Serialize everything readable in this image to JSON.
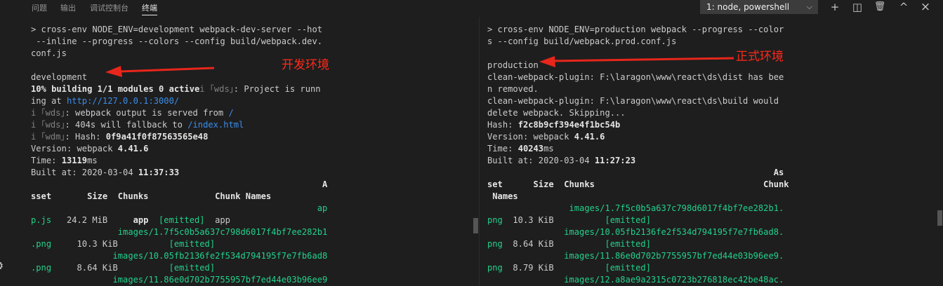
{
  "panel_tabs": [
    {
      "label": "问题"
    },
    {
      "label": "输出"
    },
    {
      "label": "调试控制台"
    },
    {
      "label": "终端"
    }
  ],
  "terminal_select": {
    "value": "1: node, powershell"
  },
  "toolbar": {
    "add_icon": "+",
    "split_icon": "◫",
    "trash_icon": "🗑",
    "maximize_icon": "^",
    "close_icon": "×"
  },
  "annotations": {
    "left": "开发环境",
    "right": "正式环境"
  },
  "left_terminal": [
    [
      {
        "t": "> cross-env NODE_ENV=development webpack-dev-server --hot",
        "c": "w"
      }
    ],
    [
      {
        "t": " --inline --progress --colors --config build/webpack.dev.",
        "c": "w"
      }
    ],
    [
      {
        "t": "conf.js",
        "c": "w"
      }
    ],
    [
      {
        "t": "",
        "c": "w"
      }
    ],
    [
      {
        "t": "development",
        "c": "w"
      }
    ],
    [
      {
        "t": "10% building 1/1 modules 0 active",
        "c": "b"
      },
      {
        "t": "i ｢wds｣",
        "c": "gr"
      },
      {
        "t": ": Project is runn",
        "c": "w"
      }
    ],
    [
      {
        "t": "ing at ",
        "c": "w"
      },
      {
        "t": "http://127.0.0.1:3000/",
        "c": "u"
      }
    ],
    [
      {
        "t": "i ｢wds｣",
        "c": "gr"
      },
      {
        "t": ": webpack output is served from ",
        "c": "w"
      },
      {
        "t": "/",
        "c": "u"
      }
    ],
    [
      {
        "t": "i ｢wds｣",
        "c": "gr"
      },
      {
        "t": ": 404s will fallback to ",
        "c": "w"
      },
      {
        "t": "/index.html",
        "c": "u"
      }
    ],
    [
      {
        "t": "i ｢wdm｣",
        "c": "gr"
      },
      {
        "t": ": Hash: ",
        "c": "w"
      },
      {
        "t": "0f9a41f0f87563565e48",
        "c": "b"
      }
    ],
    [
      {
        "t": "Version: webpack ",
        "c": "w"
      },
      {
        "t": "4.41.6",
        "c": "b"
      }
    ],
    [
      {
        "t": "Time: ",
        "c": "w"
      },
      {
        "t": "13119",
        "c": "b"
      },
      {
        "t": "ms",
        "c": "w"
      }
    ],
    [
      {
        "t": "Built at: 2020-03-04 ",
        "c": "w"
      },
      {
        "t": "11:37:33",
        "c": "b"
      }
    ],
    [
      {
        "t": "                                                         A",
        "c": "b"
      }
    ],
    [
      {
        "t": "sset       Size  Chunks             Chunk Names",
        "c": "b"
      }
    ],
    [
      {
        "t": "                                                        ap",
        "c": "g"
      }
    ],
    [
      {
        "t": "p.js",
        "c": "g"
      },
      {
        "t": "   24.2 MiB     ",
        "c": "w"
      },
      {
        "t": "app",
        "c": "b"
      },
      {
        "t": "  ",
        "c": "w"
      },
      {
        "t": "[emitted]",
        "c": "g"
      },
      {
        "t": "  app",
        "c": "w"
      }
    ],
    [
      {
        "t": "                 images/1.7f5c0b5a637c798d6017f4bf7ee282b1",
        "c": "g"
      }
    ],
    [
      {
        "t": ".png",
        "c": "g"
      },
      {
        "t": "     10.3 KiB          ",
        "c": "w"
      },
      {
        "t": "[emitted]",
        "c": "g"
      }
    ],
    [
      {
        "t": "                images/10.05fb2136fe2f534d794195f7e7fb6ad8",
        "c": "g"
      }
    ],
    [
      {
        "t": ".png",
        "c": "g"
      },
      {
        "t": "     8.64 KiB          ",
        "c": "w"
      },
      {
        "t": "[emitted]",
        "c": "g"
      }
    ],
    [
      {
        "t": "                images/11.86e0d702b7755957bf7ed44e03b96ee9",
        "c": "g"
      }
    ]
  ],
  "right_terminal": [
    [
      {
        "t": "> cross-env NODE_ENV=production webpack --progress --color",
        "c": "w"
      }
    ],
    [
      {
        "t": "s --config build/webpack.prod.conf.js",
        "c": "w"
      }
    ],
    [
      {
        "t": "",
        "c": "w"
      }
    ],
    [
      {
        "t": "production",
        "c": "w"
      }
    ],
    [
      {
        "t": "clean-webpack-plugin: F:\\laragon\\www\\react\\ds\\dist has bee",
        "c": "w"
      }
    ],
    [
      {
        "t": "n removed.",
        "c": "w"
      }
    ],
    [
      {
        "t": "clean-webpack-plugin: F:\\laragon\\www\\react\\ds\\build would",
        "c": "w"
      }
    ],
    [
      {
        "t": "delete webpack. Skipping...",
        "c": "w"
      }
    ],
    [
      {
        "t": "Hash: ",
        "c": "w"
      },
      {
        "t": "f2c8b9cf394e4f1bc54b",
        "c": "b"
      }
    ],
    [
      {
        "t": "Version: webpack ",
        "c": "w"
      },
      {
        "t": "4.41.6",
        "c": "b"
      }
    ],
    [
      {
        "t": "Time: ",
        "c": "w"
      },
      {
        "t": "40243",
        "c": "b"
      },
      {
        "t": "ms",
        "c": "w"
      }
    ],
    [
      {
        "t": "Built at: 2020-03-04 ",
        "c": "w"
      },
      {
        "t": "11:27:23",
        "c": "b"
      }
    ],
    [
      {
        "t": "                                                        As",
        "c": "b"
      }
    ],
    [
      {
        "t": "set      Size  Chunks                                 Chunk",
        "c": "b"
      }
    ],
    [
      {
        "t": " Names",
        "c": "b"
      }
    ],
    [
      {
        "t": "                images/1.7f5c0b5a637c798d6017f4bf7ee282b1.",
        "c": "g"
      }
    ],
    [
      {
        "t": "png",
        "c": "g"
      },
      {
        "t": "  10.3 KiB          ",
        "c": "w"
      },
      {
        "t": "[emitted]",
        "c": "g"
      }
    ],
    [
      {
        "t": "               images/10.05fb2136fe2f534d794195f7e7fb6ad8.",
        "c": "g"
      }
    ],
    [
      {
        "t": "png",
        "c": "g"
      },
      {
        "t": "  8.64 KiB          ",
        "c": "w"
      },
      {
        "t": "[emitted]",
        "c": "g"
      }
    ],
    [
      {
        "t": "               images/11.86e0d702b7755957bf7ed44e03b96ee9.",
        "c": "g"
      }
    ],
    [
      {
        "t": "png",
        "c": "g"
      },
      {
        "t": "  8.79 KiB          ",
        "c": "w"
      },
      {
        "t": "[emitted]",
        "c": "g"
      }
    ],
    [
      {
        "t": "               images/12.a8ae9a2315c0723b276818ec42be48ac.",
        "c": "g"
      }
    ]
  ]
}
